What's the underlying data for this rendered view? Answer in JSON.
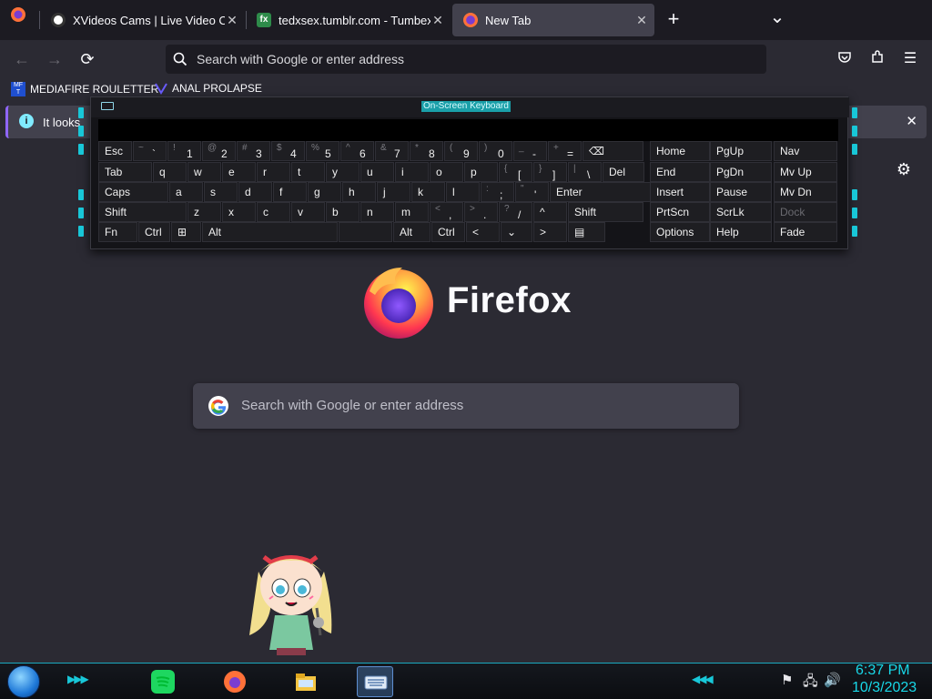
{
  "browser": {
    "tabs": [
      {
        "title": "XVideos Cams | Live Video Chat",
        "favicon": "xvideos-icon"
      },
      {
        "title": "tedxsex.tumblr.com - Tumbex",
        "favicon": "tumbex-icon"
      },
      {
        "title": "New Tab",
        "favicon": "firefox-icon",
        "active": true
      }
    ],
    "new_tab_label": "+",
    "tab_list_label": "⌄",
    "address_placeholder": "Search with Google or enter address",
    "bookmarks": [
      {
        "label": "MEDIAFIRE ROULETTER",
        "icon_text": "MF T"
      },
      {
        "label": "ANAL PROLAPSE"
      }
    ],
    "notification": {
      "text": "It looks",
      "close": "✕"
    }
  },
  "page": {
    "brand": "Firefox",
    "search_placeholder": "Search with Google or enter address"
  },
  "osk": {
    "title": "On-Screen Keyboard",
    "rows": [
      [
        {
          "label": "Esc"
        },
        {
          "shift": "~",
          "label": "`"
        },
        {
          "shift": "!",
          "label": "1"
        },
        {
          "shift": "@",
          "label": "2"
        },
        {
          "shift": "#",
          "label": "3"
        },
        {
          "shift": "$",
          "label": "4"
        },
        {
          "shift": "%",
          "label": "5"
        },
        {
          "shift": "^",
          "label": "6"
        },
        {
          "shift": "&",
          "label": "7"
        },
        {
          "shift": "*",
          "label": "8"
        },
        {
          "shift": "(",
          "label": "9"
        },
        {
          "shift": ")",
          "label": "0"
        },
        {
          "shift": "_",
          "label": "-"
        },
        {
          "shift": "+",
          "label": "="
        },
        {
          "label": "⌫"
        }
      ],
      [
        {
          "label": "Tab"
        },
        {
          "label": "q"
        },
        {
          "label": "w"
        },
        {
          "label": "e"
        },
        {
          "label": "r"
        },
        {
          "label": "t"
        },
        {
          "label": "y"
        },
        {
          "label": "u"
        },
        {
          "label": "i"
        },
        {
          "label": "o"
        },
        {
          "label": "p"
        },
        {
          "shift": "{",
          "label": "["
        },
        {
          "shift": "}",
          "label": "]"
        },
        {
          "shift": "|",
          "label": "\\"
        },
        {
          "label": "Del"
        }
      ],
      [
        {
          "label": "Caps"
        },
        {
          "label": "a"
        },
        {
          "label": "s"
        },
        {
          "label": "d"
        },
        {
          "label": "f"
        },
        {
          "label": "g"
        },
        {
          "label": "h"
        },
        {
          "label": "j"
        },
        {
          "label": "k"
        },
        {
          "label": "l"
        },
        {
          "shift": ":",
          "label": ";"
        },
        {
          "shift": "\"",
          "label": "'"
        },
        {
          "label": "Enter"
        }
      ],
      [
        {
          "label": "Shift"
        },
        {
          "label": "z"
        },
        {
          "label": "x"
        },
        {
          "label": "c"
        },
        {
          "label": "v"
        },
        {
          "label": "b"
        },
        {
          "label": "n"
        },
        {
          "label": "m"
        },
        {
          "shift": "<",
          "label": ","
        },
        {
          "shift": ">",
          "label": "."
        },
        {
          "shift": "?",
          "label": "/"
        },
        {
          "label": "^"
        },
        {
          "label": "Shift"
        }
      ],
      [
        {
          "label": "Fn"
        },
        {
          "label": "Ctrl"
        },
        {
          "label": "⊞"
        },
        {
          "label": "Alt"
        },
        {
          "label": ""
        },
        {
          "label": "Alt"
        },
        {
          "label": "Ctrl"
        },
        {
          "label": "<"
        },
        {
          "label": "⌄"
        },
        {
          "label": ">"
        },
        {
          "label": "▤"
        }
      ]
    ],
    "side_rows": [
      [
        "Home",
        "PgUp",
        "Nav"
      ],
      [
        "End",
        "PgDn",
        "Mv Up"
      ],
      [
        "Insert",
        "Pause",
        "Mv Dn"
      ],
      [
        "PrtScn",
        "ScrLk",
        "Dock"
      ],
      [
        "Options",
        "Help",
        "Fade"
      ]
    ]
  },
  "taskbar": {
    "apps": [
      "spotify-icon",
      "firefox-icon",
      "file-explorer-icon",
      "on-screen-keyboard-icon"
    ],
    "time": "6:37 PM",
    "date": "10/3/2023"
  },
  "colors": {
    "accent": "#18c7d8",
    "browser_bg": "#2b2a33",
    "tabbar_bg": "#1c1b22"
  }
}
